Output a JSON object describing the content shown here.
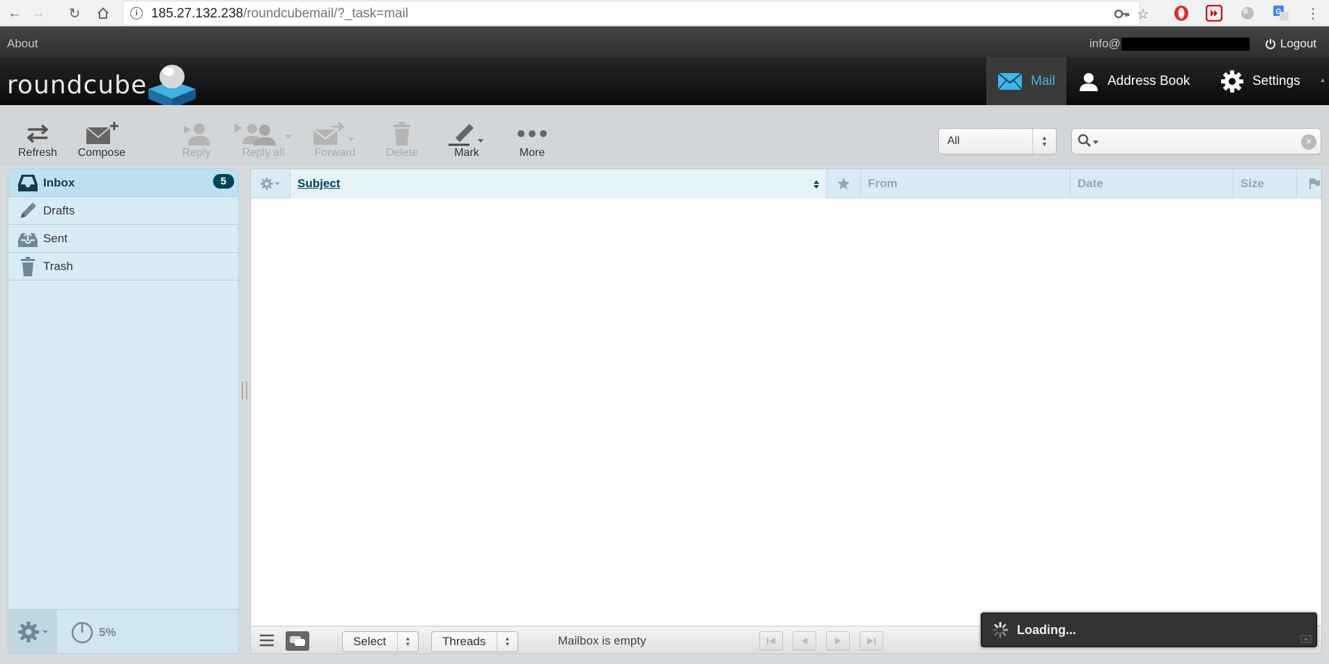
{
  "browser": {
    "url_host": "185.27.132.238",
    "url_path": "/roundcubemail/?_task=mail"
  },
  "topline": {
    "about": "About",
    "user_email": "info@",
    "logout": "Logout"
  },
  "header": {
    "logo_text": "roundcube",
    "tasks": [
      {
        "label": "Mail",
        "active": true
      },
      {
        "label": "Address Book",
        "active": false
      },
      {
        "label": "Settings",
        "active": false
      }
    ]
  },
  "toolbar": {
    "refresh": "Refresh",
    "compose": "Compose",
    "reply": "Reply",
    "reply_all": "Reply all",
    "forward": "Forward",
    "delete": "Delete",
    "mark": "Mark",
    "more": "More"
  },
  "filter": {
    "selected": "All"
  },
  "search": {
    "placeholder": ""
  },
  "folders": {
    "items": [
      {
        "label": "Inbox",
        "unread": "5",
        "selected": true
      },
      {
        "label": "Drafts"
      },
      {
        "label": "Sent"
      },
      {
        "label": "Trash"
      }
    ],
    "quota": "5%"
  },
  "list": {
    "columns": {
      "subject": "Subject",
      "from": "From",
      "date": "Date",
      "size": "Size"
    },
    "footer": {
      "select": "Select",
      "threads": "Threads",
      "count_text": "Mailbox is empty"
    }
  },
  "status": {
    "loading": "Loading..."
  },
  "colors": {
    "accent": "#3cb8e8",
    "badge": "#004458",
    "folder_bg": "#d8ecf5"
  }
}
